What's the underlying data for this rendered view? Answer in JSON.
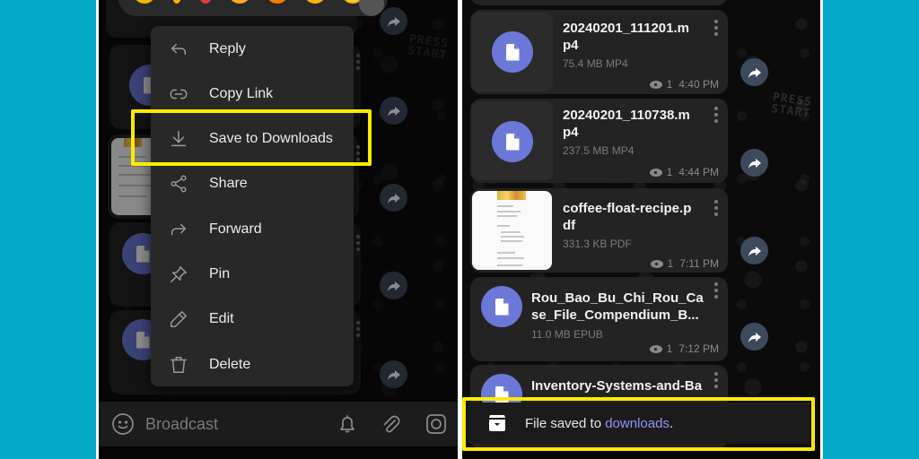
{
  "colors": {
    "background": "#00a9c6",
    "highlight": "#ffeb00",
    "file_icon": "#6c78d8",
    "link": "#8c97ef"
  },
  "left_panel": {
    "context_menu": {
      "items": [
        {
          "id": "reply",
          "label": "Reply",
          "icon": "reply-icon"
        },
        {
          "id": "copy-link",
          "label": "Copy Link",
          "icon": "link-icon"
        },
        {
          "id": "save-to-downloads",
          "label": "Save to Downloads",
          "icon": "download-icon",
          "highlighted": true
        },
        {
          "id": "share",
          "label": "Share",
          "icon": "share-icon"
        },
        {
          "id": "forward",
          "label": "Forward",
          "icon": "forward-icon"
        },
        {
          "id": "pin",
          "label": "Pin",
          "icon": "pin-icon"
        },
        {
          "id": "edit",
          "label": "Edit",
          "icon": "pencil-icon"
        },
        {
          "id": "delete",
          "label": "Delete",
          "icon": "trash-icon"
        }
      ]
    },
    "input_bar": {
      "placeholder": "Broadcast"
    }
  },
  "right_panel": {
    "messages": [
      {
        "name": "20240201_111201.mp4",
        "size": "75.4 MB MP4",
        "views": "1",
        "time": "4:40 PM",
        "thumb": "file"
      },
      {
        "name": "20240201_110738.mp4",
        "size": "237.5 MB MP4",
        "views": "1",
        "time": "4:44 PM",
        "thumb": "file"
      },
      {
        "name": "coffee-float-recipe.pdf",
        "size": "331.3 KB PDF",
        "views": "1",
        "time": "7:11 PM",
        "thumb": "pdf"
      },
      {
        "name": "Rou_Bao_Bu_Chi_Rou_Case_File_Compendium_B...",
        "size": "11.0 MB EPUB",
        "views": "1",
        "time": "7:12 PM",
        "thumb": "file"
      },
      {
        "name": "Inventory-Systems-and-Ba",
        "size": "",
        "views": "",
        "time": "",
        "thumb": "file"
      }
    ],
    "toast": {
      "prefix": "File saved to ",
      "link": "downloads",
      "suffix": "."
    }
  }
}
